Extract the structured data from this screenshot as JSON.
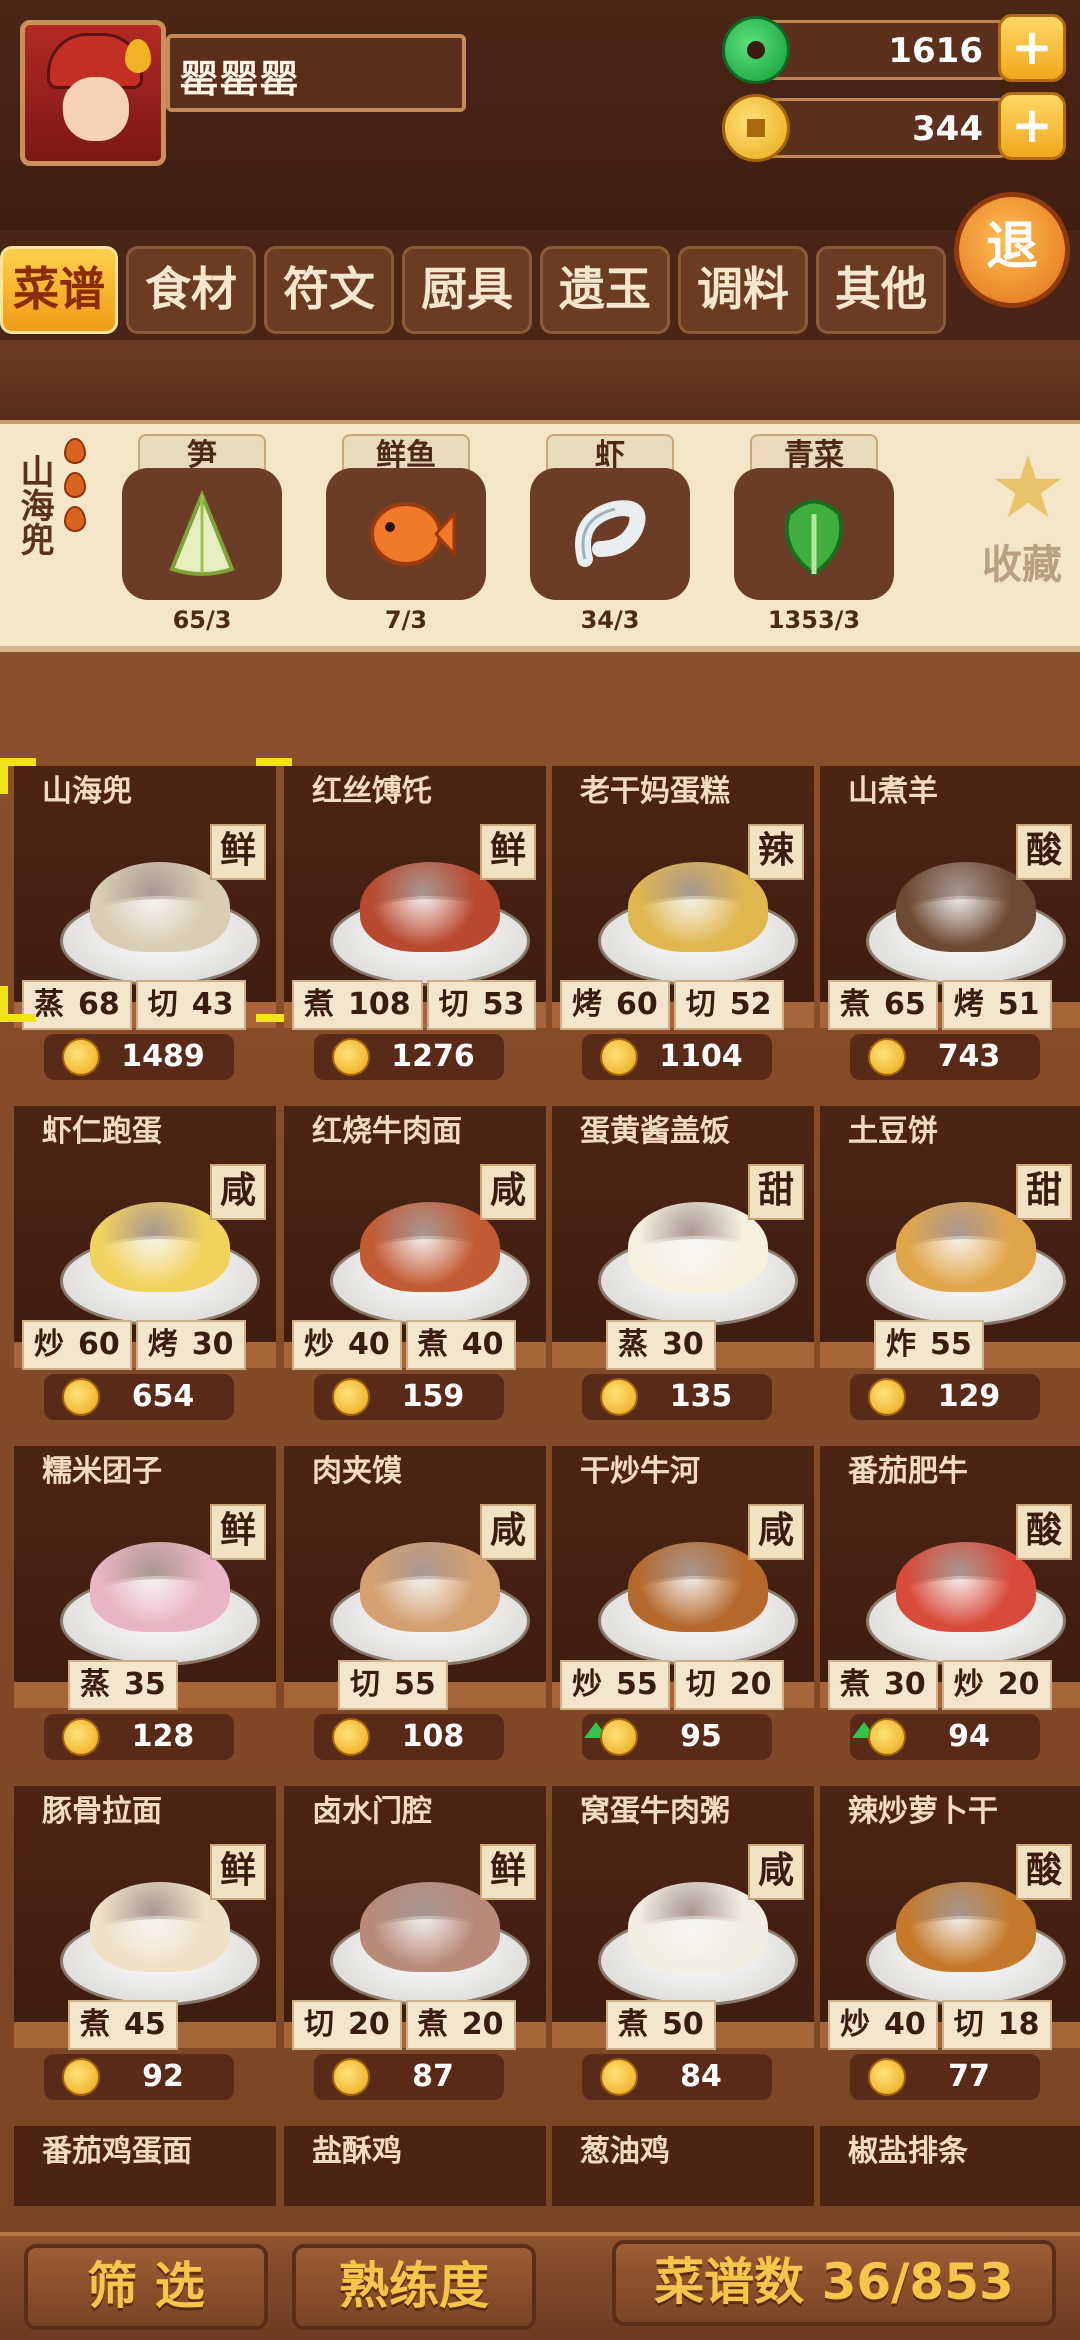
{
  "player": {
    "name": "罂罂罂"
  },
  "currency": {
    "jade": "1616",
    "coins": "344",
    "plus": "+"
  },
  "exit_label": "退",
  "tabs": [
    "菜谱",
    "食材",
    "符文",
    "厨具",
    "遗玉",
    "调料",
    "其他"
  ],
  "selected_dish": {
    "name_vertical": "山海兜",
    "ingredients": [
      {
        "label": "笋",
        "count": "65/3",
        "icon": "bamboo-shoot-icon"
      },
      {
        "label": "鲜鱼",
        "count": "7/3",
        "icon": "fish-icon"
      },
      {
        "label": "虾",
        "count": "34/3",
        "icon": "shrimp-icon"
      },
      {
        "label": "青菜",
        "count": "1353/3",
        "icon": "greens-icon"
      }
    ],
    "favorite_label": "收藏"
  },
  "recipes": [
    {
      "name": "山海兜",
      "flavor": "鲜",
      "skills": [
        [
          "蒸",
          "68"
        ],
        [
          "切",
          "43"
        ]
      ],
      "price": "1489",
      "up": false
    },
    {
      "name": "红丝馎饦",
      "flavor": "鲜",
      "skills": [
        [
          "煮",
          "108"
        ],
        [
          "切",
          "53"
        ]
      ],
      "price": "1276",
      "up": false
    },
    {
      "name": "老干妈蛋糕",
      "flavor": "辣",
      "skills": [
        [
          "烤",
          "60"
        ],
        [
          "切",
          "52"
        ]
      ],
      "price": "1104",
      "up": false
    },
    {
      "name": "山煮羊",
      "flavor": "酸",
      "skills": [
        [
          "煮",
          "65"
        ],
        [
          "烤",
          "51"
        ]
      ],
      "price": "743",
      "up": false
    },
    {
      "name": "虾仁跑蛋",
      "flavor": "咸",
      "skills": [
        [
          "炒",
          "60"
        ],
        [
          "烤",
          "30"
        ]
      ],
      "price": "654",
      "up": false
    },
    {
      "name": "红烧牛肉面",
      "flavor": "咸",
      "skills": [
        [
          "炒",
          "40"
        ],
        [
          "煮",
          "40"
        ]
      ],
      "price": "159",
      "up": false
    },
    {
      "name": "蛋黄酱盖饭",
      "flavor": "甜",
      "skills": [
        [
          "蒸",
          "30"
        ]
      ],
      "price": "135",
      "up": false
    },
    {
      "name": "土豆饼",
      "flavor": "甜",
      "skills": [
        [
          "炸",
          "55"
        ]
      ],
      "price": "129",
      "up": false
    },
    {
      "name": "糯米团子",
      "flavor": "鲜",
      "skills": [
        [
          "蒸",
          "35"
        ]
      ],
      "price": "128",
      "up": false
    },
    {
      "name": "肉夹馍",
      "flavor": "咸",
      "skills": [
        [
          "切",
          "55"
        ]
      ],
      "price": "108",
      "up": false
    },
    {
      "name": "干炒牛河",
      "flavor": "咸",
      "skills": [
        [
          "炒",
          "55"
        ],
        [
          "切",
          "20"
        ]
      ],
      "price": "95",
      "up": true
    },
    {
      "name": "番茄肥牛",
      "flavor": "酸",
      "skills": [
        [
          "煮",
          "30"
        ],
        [
          "炒",
          "20"
        ]
      ],
      "price": "94",
      "up": true
    },
    {
      "name": "豚骨拉面",
      "flavor": "鲜",
      "skills": [
        [
          "煮",
          "45"
        ]
      ],
      "price": "92",
      "up": false
    },
    {
      "name": "卤水门腔",
      "flavor": "鲜",
      "skills": [
        [
          "切",
          "20"
        ],
        [
          "煮",
          "20"
        ]
      ],
      "price": "87",
      "up": false
    },
    {
      "name": "窝蛋牛肉粥",
      "flavor": "咸",
      "skills": [
        [
          "煮",
          "50"
        ]
      ],
      "price": "84",
      "up": false
    },
    {
      "name": "辣炒萝卜干",
      "flavor": "酸",
      "skills": [
        [
          "炒",
          "40"
        ],
        [
          "切",
          "18"
        ]
      ],
      "price": "77",
      "up": false
    }
  ],
  "partial_recipes": [
    "番茄鸡蛋面",
    "盐酥鸡",
    "葱油鸡",
    "椒盐排条"
  ],
  "bottom": {
    "filter": "筛 选",
    "proficiency": "熟练度",
    "count": "菜谱数 36/853"
  }
}
